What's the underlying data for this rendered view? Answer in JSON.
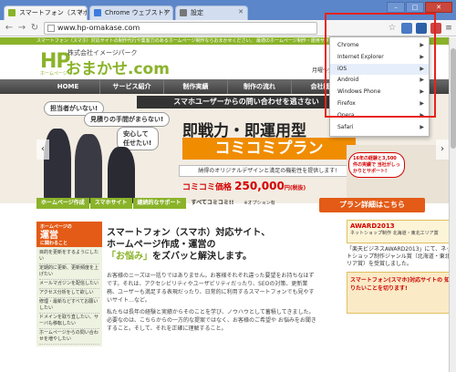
{
  "browser": {
    "tabs": [
      {
        "label": "スマートフォン（スマホ）",
        "active": true,
        "favicon_color": "#8ab32a"
      },
      {
        "label": "Chrome ウェブストア",
        "active": false,
        "favicon_color": "#3b7ddd"
      },
      {
        "label": "設定",
        "active": false,
        "favicon_color": "#777777"
      }
    ],
    "url": "www.hp-omakase.com",
    "window_buttons": {
      "minimize": "–",
      "maximize": "□",
      "close": "✕"
    }
  },
  "site": {
    "top_strip": "スマートフォン（スマホ）対応サイトの制作代行や集客力のあるホームページ制作ならおまかせください。 最適のホームページ制作・運用サポートを",
    "logo": {
      "hp": "HP",
      "company": "株式会社イメージパーク",
      "name": "おまかせ.com",
      "small": "ホームページ"
    },
    "header_right": "月曜～金曜",
    "nav": [
      "HOME",
      "サービス紹介",
      "制作実績",
      "制作の流れ",
      "会社概要"
    ],
    "hero": {
      "strip": "スマホユーザーからの問い合わせを逃さない",
      "bubble1": "見積りの手間がまらない!",
      "bubble2": "担当者がいない!",
      "bubble3": "安心して任せたい!",
      "title1": "即戦力・即運用型",
      "title2": "コミコミプラン",
      "desc": "納得のオリジナルデザインと満足の機能性を提供します!",
      "price_label": "コミコミ価格",
      "price_value": "250,000",
      "price_unit": "円(税抜)",
      "right_bubble": "16年の経験と3,500件の実績で 当社がしっかりとサポート!",
      "prev": "‹",
      "next": "›"
    },
    "hero_tabs": [
      "ホームページ作成",
      "スマホサイト",
      "継続的なサポート",
      "すべてコミコミ!!",
      "※オプション有"
    ],
    "detail_button": "プラン詳細はこちら",
    "sidebar": {
      "head_small": "ホームページの",
      "head_big": "運営",
      "head_tail": "に関わること",
      "items": [
        "目的を更新をするようにしたい",
        "定期的に更新、更新頻度を上げたい",
        "メールマガジンを配信したい",
        "アクセス分析をして欲しい",
        "修理・最新などすべてお願いしたい",
        "ドメインを取り直したい、サーバも移転したい",
        "ホームページからの問い合わせを増やしたい"
      ]
    },
    "main": {
      "heading_line1": "スマートフォン（スマホ）対応サイト、",
      "heading_line2": "ホームページ作成・運営の",
      "heading_line3a": "「お悩み」",
      "heading_line3b": "をズバッと解決します。",
      "para1": "お客様のニーズは一括りではありません。お客様それぞれ違った要望をお持ちなはずです。それは、アクセシビリティやユーザビリティだったり、SEOの対策、更新業務、ユーザーも満足する表現だったり、日常的に利用するスマートフォンでも見やすいサイト…など。",
      "para2": "私たちは長年の経験と実績からそのことを学び、ノウハウとして蓄積してきました。必要なのは、こちらからの一方的な提案ではなく、お客様のご希望や お悩みをお聞きすること。そして、それを正確に理解すること。"
    },
    "right_column": {
      "card1_title": "AWARD2013",
      "card1_sub": "ネットショップ制作 北海道・東北エリア賞",
      "award_text": "「楽天ビジネスAWARD2013」にて、ネットショップ制作ジャンル賞（北海道・東北エリア賞）を受賞しました。",
      "card2_text": "スマートフォン(スマホ)対応サイトの 知りたいことを切ります!"
    }
  },
  "dropdown": {
    "items": [
      {
        "label": "Chrome",
        "selected": false
      },
      {
        "label": "Internet Explorer",
        "selected": false
      },
      {
        "label": "iOS",
        "selected": true
      },
      {
        "label": "Android",
        "selected": false
      },
      {
        "label": "Windows Phone",
        "selected": false
      },
      {
        "label": "Firefox",
        "selected": false
      },
      {
        "label": "Opera",
        "selected": false
      },
      {
        "label": "Safari",
        "selected": false
      }
    ],
    "arrow": "▶"
  },
  "colors": {
    "brand_green": "#8ab32a",
    "accent_orange": "#e35b16",
    "highlight_red": "#e8231b"
  }
}
